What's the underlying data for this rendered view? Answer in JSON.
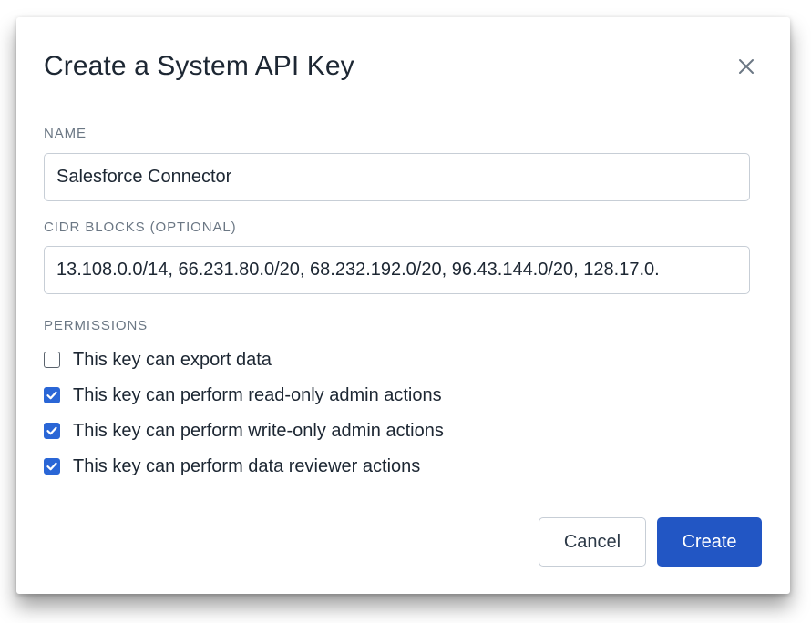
{
  "dialog": {
    "title": "Create a System API Key",
    "close_icon": "close-icon"
  },
  "fields": {
    "name": {
      "label": "NAME",
      "value": "Salesforce Connector"
    },
    "cidr": {
      "label": "CIDR BLOCKS (OPTIONAL)",
      "value": "13.108.0.0/14, 66.231.80.0/20, 68.232.192.0/20, 96.43.144.0/20, 128.17.0."
    }
  },
  "permissions": {
    "label": "PERMISSIONS",
    "items": [
      {
        "label": "This key can export data",
        "checked": false
      },
      {
        "label": "This key can perform read-only admin actions",
        "checked": true
      },
      {
        "label": "This key can perform write-only admin actions",
        "checked": true
      },
      {
        "label": "This key can perform data reviewer actions",
        "checked": true
      }
    ]
  },
  "buttons": {
    "cancel": "Cancel",
    "create": "Create"
  },
  "colors": {
    "primary": "#2256c4",
    "checkbox_checked": "#2a66d6",
    "label_gray": "#6b7784",
    "text": "#1d2733"
  }
}
